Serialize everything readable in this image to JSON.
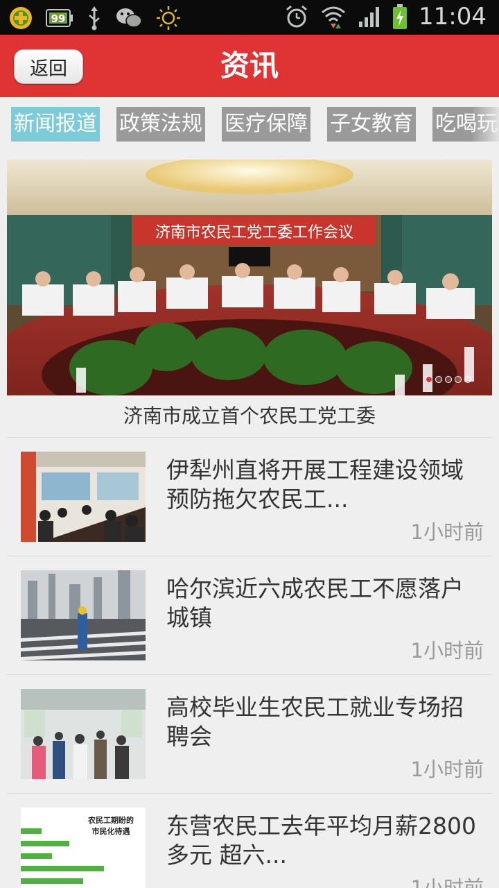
{
  "status_bar": {
    "time": "11:04",
    "badge": "99",
    "icons": [
      "app-icon",
      "badge-99-icon",
      "usb-icon",
      "wechat-icon",
      "brightness-icon",
      "alarm-icon",
      "wifi-icon",
      "signal-icon",
      "battery-charging-icon"
    ]
  },
  "header": {
    "back_label": "返回",
    "title": "资讯"
  },
  "tabs": [
    {
      "label": "新闻报道",
      "active": true
    },
    {
      "label": "政策法规",
      "active": false
    },
    {
      "label": "医疗保障",
      "active": false
    },
    {
      "label": "子女教育",
      "active": false
    },
    {
      "label": "吃喝玩乐",
      "active": false
    }
  ],
  "banner": {
    "sign_text": "济南市农民工党工委工作会议",
    "caption": "济南市成立首个农民工党工委",
    "page_count": 5,
    "current_page": 1
  },
  "news": [
    {
      "title": "伊犁州直将开展工程建设领域预防拖欠农民工...",
      "time": "1小时前"
    },
    {
      "title": "哈尔滨近六成农民工不愿落户城镇",
      "time": "1小时前"
    },
    {
      "title": "高校毕业生农民工就业专场招聘会",
      "time": "1小时前"
    },
    {
      "title": "东营农民工去年平均月薪2800多元 超六...",
      "time": "1小时前",
      "thumb_text": [
        "农民工期盼的",
        "市民化待遇"
      ]
    }
  ],
  "colors": {
    "header_red": "#e03434",
    "tab_active": "#7ccbd8",
    "tab_inactive": "#9a9a9a"
  }
}
